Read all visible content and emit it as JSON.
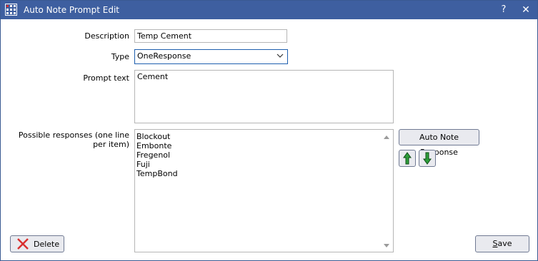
{
  "window": {
    "title": "Auto Note Prompt Edit",
    "help_label": "?",
    "close_label": "✕"
  },
  "form": {
    "description_label": "Description",
    "description_value": "Temp Cement",
    "type_label": "Type",
    "type_value": "OneResponse",
    "prompt_label": "Prompt text",
    "prompt_value": "Cement",
    "responses_label": "Possible responses (one line per item)",
    "responses": [
      "Blockout",
      "Embonte",
      "Fregenol",
      "Fuji",
      "TempBond"
    ]
  },
  "buttons": {
    "auto_note_response": "Auto Note Response",
    "delete": "Delete",
    "save": "Save"
  },
  "colors": {
    "titlebar": "#3e5fa0",
    "arrow_green": "#2e9e3a",
    "delete_red": "#d93030"
  }
}
